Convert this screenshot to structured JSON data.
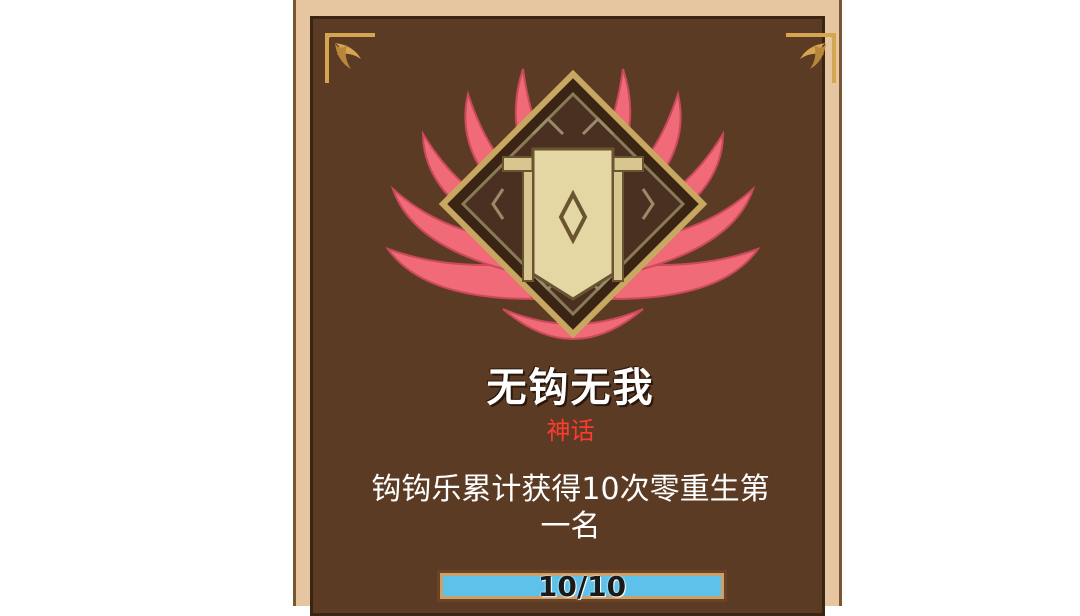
{
  "achievement": {
    "title": "无钩无我",
    "rarity": "神话",
    "description": "钩钩乐累计获得10次零重生第一名",
    "progress_text": "10/10",
    "progress_fraction": 1.0
  },
  "colors": {
    "card_border": "#e6c6a0",
    "card_bg": "#5c3b24",
    "rarity": "#ff3b2f",
    "wings": "#f06a78",
    "badge_gold": "#d8c690",
    "progress_fill": "#5ec1ea"
  },
  "icons": {
    "emblem": "winged-banner-badge-icon",
    "corner": "corner-ornament-icon"
  }
}
